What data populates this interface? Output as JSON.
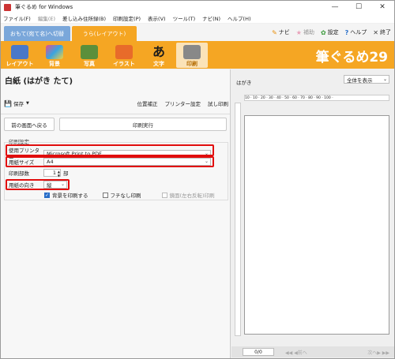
{
  "window": {
    "title": "筆ぐるめ for Windows",
    "controls": [
      "—",
      "☐",
      "✕"
    ]
  },
  "menu": [
    {
      "label": "ファイル(F)",
      "dim": false
    },
    {
      "label": "編集(E)",
      "dim": true
    },
    {
      "label": "差し込み住所録(B)",
      "dim": false
    },
    {
      "label": "印刷設定(P)",
      "dim": false
    },
    {
      "label": "表示(V)",
      "dim": false
    },
    {
      "label": "ツール(T)",
      "dim": false
    },
    {
      "label": "ナビ(N)",
      "dim": false
    },
    {
      "label": "ヘルプ(H)",
      "dim": false
    }
  ],
  "tabs": {
    "front": "おもて(宛て名)へ切替",
    "back": "うら(レイアウト)"
  },
  "links": [
    {
      "icon": "navi-icon",
      "glyph": "✎",
      "label": "ナビ",
      "dim": false
    },
    {
      "icon": "assist-icon",
      "glyph": "★",
      "label": "補助",
      "dim": true
    },
    {
      "icon": "settings-icon",
      "glyph": "✿",
      "label": "設定",
      "dim": false
    },
    {
      "icon": "help-icon",
      "glyph": "?",
      "label": "ヘルプ",
      "dim": false
    },
    {
      "icon": "exit-icon",
      "glyph": "✕",
      "label": "終了",
      "dim": false
    }
  ],
  "ribbon": {
    "buttons": [
      {
        "label": "レイアウト",
        "color": "#4a78c8"
      },
      {
        "label": "背景",
        "color": "#e84e8a"
      },
      {
        "label": "写真",
        "color": "#5b8f3b"
      },
      {
        "label": "イラスト",
        "color": "#e86b2a"
      },
      {
        "label": "文字",
        "color": "#1c1c1c"
      },
      {
        "label": "印刷",
        "color": "#888888"
      }
    ],
    "brand": "筆ぐるめ29"
  },
  "left": {
    "title": "白紙 (はがき たて)",
    "save": "保存",
    "toolbar": [
      "位置補正",
      "プリンター設定",
      "試し印刷"
    ],
    "back_button": "前の画面へ戻る",
    "print_button": "印刷実行",
    "section": "印刷設定",
    "printer_label": "使用プリンター",
    "printer_value": "Microsoft Print to PDF",
    "paper_label": "用紙サイズ",
    "paper_value": "A4",
    "copies_label": "印刷部数",
    "copies_value": "1",
    "copies_unit": "部",
    "orient_label": "用紙の向き",
    "orient_value": "縦",
    "opt_bg": "背景を印刷する",
    "opt_border": "フチなし印刷",
    "opt_mirror": "鏡面(左右反転)印刷"
  },
  "right": {
    "label": "はがき",
    "zoom": "全体を表示",
    "hruler": "10 · 10 · 20 · 30 · 40 · 50 · 60 · 70 · 80 · 90 · 100 ·",
    "page": "0/0",
    "prev": "◀◀ ◀前へ",
    "next": "次へ▶ ▶▶"
  },
  "colors": {
    "orange": "#f5a623",
    "blue_tab": "#7aa7da",
    "highlight": "#e10d0d"
  }
}
